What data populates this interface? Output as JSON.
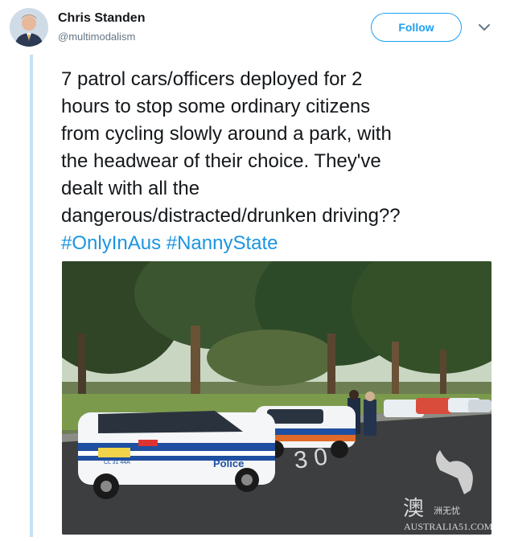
{
  "author": {
    "name": "Chris Standen",
    "handle": "@multimodalism",
    "avatar_icon": "user-avatar"
  },
  "follow_label": "Follow",
  "menu_icon": "chevron-down-icon",
  "tweet": {
    "lines": [
      "7 patrol cars/officers deployed for 2",
      "hours to stop some ordinary citizens",
      "from cycling slowly around a park, with",
      "the headwear of their choice. They've",
      "dealt with all the",
      "dangerous/distracted/drunken driving??"
    ],
    "hashtags": [
      "#OnlyInAus",
      "#NannyState"
    ]
  },
  "photo": {
    "car_text": "Police",
    "plate_text": "CL 31 44A",
    "watermark_char": "澳",
    "watermark_sub": "洲无忧",
    "watermark_text": "AUSTRALIA51.COM"
  },
  "colors": {
    "accent": "#1da1f2",
    "hashtag": "#1b95e0",
    "thread_line": "#c4e2f6"
  }
}
